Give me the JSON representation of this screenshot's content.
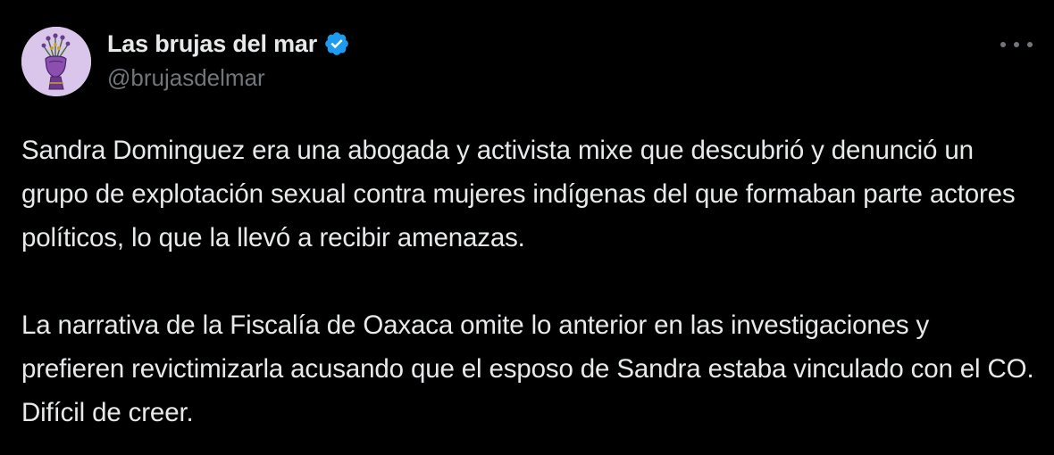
{
  "author": {
    "display_name": "Las brujas del mar",
    "handle": "@brujasdelmar",
    "verified": true,
    "verified_color": "#1d9bf0"
  },
  "icons": {
    "avatar": "hand-holding-flowers-illustration",
    "verified": "verified-badge-icon",
    "more": "more-options-icon"
  },
  "tweet": {
    "paragraphs": [
      "Sandra Dominguez era una abogada y activista mixe que descubrió y denunció un grupo de explotación sexual contra mujeres indígenas del que formaban parte actores políticos, lo que la llevó a recibir amenazas.",
      "La narrativa de la Fiscalía de Oaxaca omite lo anterior en las investigaciones y prefieren revictimizarla acusando que el esposo de Sandra estaba vinculado con el CO. Difícil de creer."
    ]
  },
  "colors": {
    "background": "#000000",
    "text": "#e7e9ea",
    "secondary_text": "#71767b",
    "avatar_background": "#d9c6ea"
  }
}
